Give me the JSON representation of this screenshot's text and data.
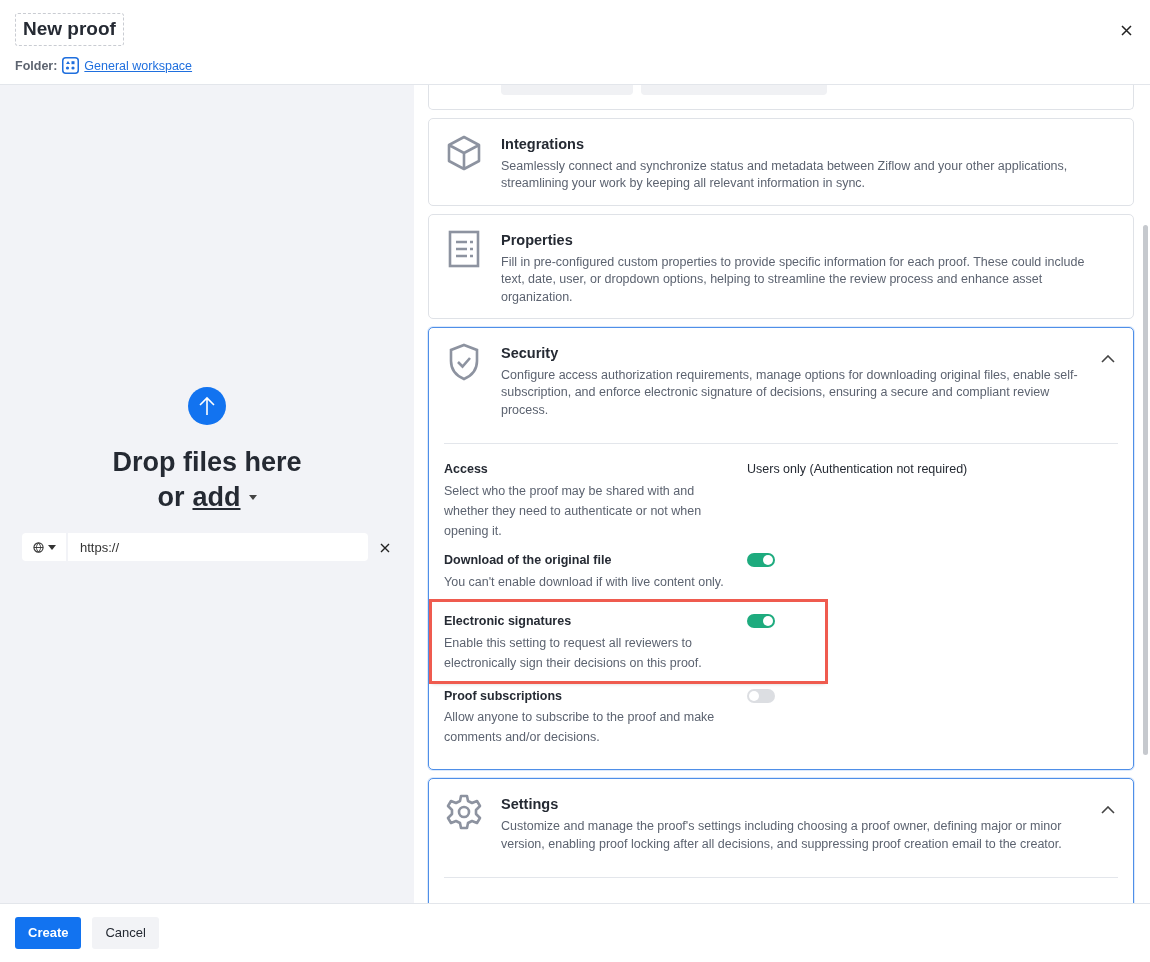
{
  "header": {
    "title": "New proof",
    "folder_label": "Folder:",
    "folder_link": "General workspace"
  },
  "upload": {
    "line1": "Drop files here",
    "or_text": "or",
    "add_link": "add",
    "url_field": {
      "value": "https://"
    }
  },
  "sections": [
    {
      "title": "Integrations",
      "description": "Seamlessly connect and synchronize status and metadata between Ziflow and your other applications, streamlining your work by keeping all relevant information in sync.",
      "expanded": false
    },
    {
      "title": "Properties",
      "description": "Fill in pre-configured custom properties to provide specific information for each proof. These could include text, date, user, or dropdown options, helping to streamline the review process and enhance asset organization.",
      "expanded": false
    },
    {
      "title": "Security",
      "description": "Configure access authorization requirements, manage options for downloading original files, enable self-subscription, and enforce electronic signature of decisions, ensuring a secure and compliant review process.",
      "expanded": true,
      "options": [
        {
          "kind": "value",
          "label": "Access",
          "description": "Select who the proof may be shared with and whether they need to authenticate or not when opening it.",
          "value": "Users only (Authentication not required)",
          "highlighted": false
        },
        {
          "kind": "toggle",
          "label": "Download of the original file",
          "description": "You can't enable download if with live content only.",
          "on": true,
          "highlighted": false
        },
        {
          "kind": "toggle",
          "label": "Electronic signatures",
          "description": "Enable this setting to request all reviewers to electronically sign their decisions on this proof.",
          "on": true,
          "highlighted": true
        },
        {
          "kind": "toggle",
          "label": "Proof subscriptions",
          "description": "Allow anyone to subscribe to the proof and make comments and/or decisions.",
          "on": false,
          "highlighted": false
        }
      ]
    },
    {
      "title": "Settings",
      "description": "Customize and manage the proof's settings including choosing a proof owner, defining major or minor version, enabling proof locking after all decisions, and suppressing proof creation email to the creator.",
      "expanded": true
    }
  ],
  "footer": {
    "buttons": [
      {
        "label": "Create",
        "kind": "primary"
      },
      {
        "label": "Cancel",
        "kind": "secondary"
      }
    ]
  }
}
